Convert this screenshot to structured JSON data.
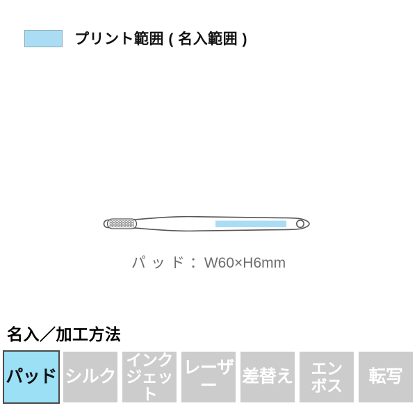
{
  "legend": {
    "swatch_color": "#aaddf4",
    "label": "プリント範囲 ( 名入範囲 )"
  },
  "product": {
    "name": "toothbrush-illustration",
    "outline_color": "#555555",
    "body_color": "#ffffff",
    "print_area_color": "#aaddf4",
    "print_area_name": "print-area-highlight"
  },
  "dimension": {
    "method_label": "パッド",
    "separator": "：",
    "value": "W60×H6mm",
    "full_text": "パッド：W60×H6mm"
  },
  "methods_section": {
    "heading": "名入／加工方法",
    "active_color": "#9ce0f5",
    "inactive_color": "#cccccc",
    "items": [
      {
        "label": "パッド",
        "lines": [
          "パッド"
        ],
        "active": true
      },
      {
        "label": "シルク",
        "lines": [
          "シルク"
        ],
        "active": false
      },
      {
        "label": "インクジェット",
        "lines": [
          "インク",
          "ジェット"
        ],
        "active": false
      },
      {
        "label": "レーザー",
        "lines": [
          "レーザー"
        ],
        "active": false
      },
      {
        "label": "差替え",
        "lines": [
          "差替え"
        ],
        "active": false
      },
      {
        "label": "エンボス",
        "lines": [
          "エン",
          "ボス"
        ],
        "active": false
      },
      {
        "label": "転写",
        "lines": [
          "転写"
        ],
        "active": false
      }
    ]
  }
}
